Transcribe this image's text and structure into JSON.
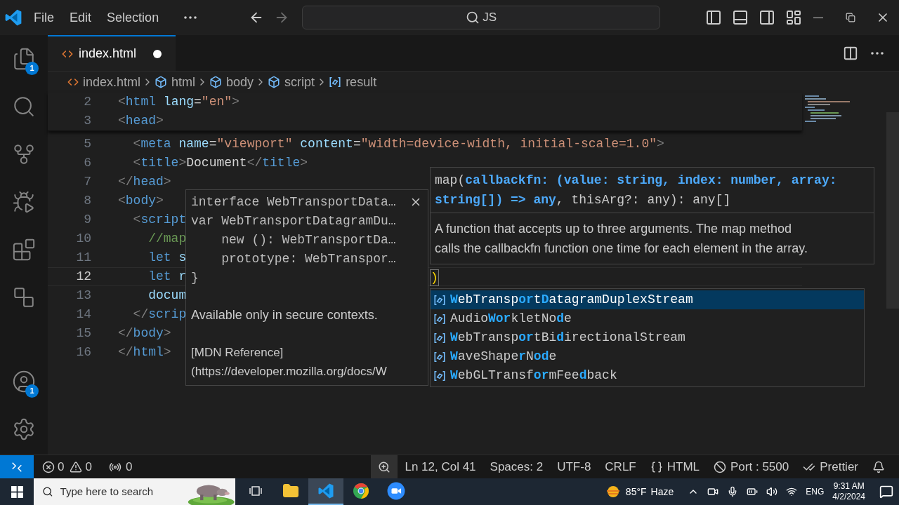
{
  "title_bar": {
    "menu": [
      "File",
      "Edit",
      "Selection"
    ],
    "command_center": "JS"
  },
  "activity_bar": {
    "top": [
      {
        "kind": "explorer",
        "badge": "1"
      },
      {
        "kind": "search"
      },
      {
        "kind": "source-control"
      },
      {
        "kind": "run-debug"
      },
      {
        "kind": "extensions"
      },
      {
        "kind": "remote"
      }
    ],
    "bottom": [
      {
        "kind": "accounts",
        "badge": "1"
      },
      {
        "kind": "settings"
      }
    ]
  },
  "tabs": [
    {
      "label": "index.html",
      "selected": true,
      "modified": true
    }
  ],
  "breadcrumbs": [
    {
      "label": "index.html",
      "kind": "file"
    },
    {
      "label": "html",
      "kind": "element"
    },
    {
      "label": "body",
      "kind": "element"
    },
    {
      "label": "script",
      "kind": "element"
    },
    {
      "label": "result",
      "kind": "variable"
    }
  ],
  "editor": {
    "sticky_lines": [
      {
        "number": "2",
        "current": false,
        "tokens": [
          {
            "kind": "p",
            "text": "<"
          },
          {
            "kind": "tag",
            "text": "html"
          },
          {
            "kind": "attr",
            "text": " lang"
          },
          {
            "kind": "text",
            "text": "="
          },
          {
            "kind": "str",
            "text": "\"en\""
          },
          {
            "kind": "p",
            "text": ">"
          }
        ]
      },
      {
        "number": "3",
        "current": false,
        "tokens": [
          {
            "kind": "p",
            "text": "<"
          },
          {
            "kind": "tag",
            "text": "head"
          },
          {
            "kind": "p",
            "text": ">"
          }
        ]
      }
    ],
    "lines": [
      {
        "number": "5",
        "current": false,
        "tokens": [
          {
            "kind": "p",
            "text": "  <"
          },
          {
            "kind": "tag",
            "text": "meta"
          },
          {
            "kind": "attr",
            "text": " name"
          },
          {
            "kind": "text",
            "text": "="
          },
          {
            "kind": "str",
            "text": "\"viewport\""
          },
          {
            "kind": "attr",
            "text": " content"
          },
          {
            "kind": "text",
            "text": "="
          },
          {
            "kind": "str",
            "text": "\"width=device-width, initial-scale=1.0\""
          },
          {
            "kind": "p",
            "text": ">"
          }
        ]
      },
      {
        "number": "6",
        "current": false,
        "tokens": [
          {
            "kind": "p",
            "text": "  <"
          },
          {
            "kind": "tag",
            "text": "title"
          },
          {
            "kind": "p",
            "text": ">"
          },
          {
            "kind": "text",
            "text": "Document"
          },
          {
            "kind": "p",
            "text": "</"
          },
          {
            "kind": "tag",
            "text": "title"
          },
          {
            "kind": "p",
            "text": ">"
          }
        ]
      },
      {
        "number": "7",
        "current": false,
        "tokens": [
          {
            "kind": "p",
            "text": "</"
          },
          {
            "kind": "tag",
            "text": "head"
          },
          {
            "kind": "p",
            "text": ">"
          }
        ]
      },
      {
        "number": "8",
        "current": false,
        "tokens": [
          {
            "kind": "p",
            "text": "<"
          },
          {
            "kind": "tag",
            "text": "body"
          },
          {
            "kind": "p",
            "text": ">"
          }
        ]
      },
      {
        "number": "9",
        "current": false,
        "tokens": [
          {
            "kind": "p",
            "text": "  <"
          },
          {
            "kind": "tag",
            "text": "script"
          }
        ]
      },
      {
        "number": "10",
        "current": false,
        "tokens": [
          {
            "kind": "comment",
            "text": "    //map"
          }
        ]
      },
      {
        "number": "11",
        "current": false,
        "tokens": [
          {
            "kind": "kw",
            "text": "    let"
          },
          {
            "kind": "var",
            "text": " s"
          }
        ]
      },
      {
        "number": "12",
        "current": true,
        "tokens": [
          {
            "kind": "kw",
            "text": "    let"
          },
          {
            "kind": "var",
            "text": " r"
          }
        ]
      },
      {
        "number": "13",
        "current": false,
        "tokens": [
          {
            "kind": "var",
            "text": "    docum"
          }
        ]
      },
      {
        "number": "14",
        "current": false,
        "tokens": [
          {
            "kind": "p",
            "text": "  </"
          },
          {
            "kind": "tag",
            "text": "scrip"
          }
        ]
      },
      {
        "number": "15",
        "current": false,
        "tokens": [
          {
            "kind": "p",
            "text": "</"
          },
          {
            "kind": "tag",
            "text": "body"
          },
          {
            "kind": "p",
            "text": ">"
          }
        ]
      },
      {
        "number": "16",
        "current": false,
        "tokens": [
          {
            "kind": "p",
            "text": "</"
          },
          {
            "kind": "tag",
            "text": "html"
          },
          {
            "kind": "p",
            "text": ">"
          }
        ]
      }
    ],
    "bracket": ")"
  },
  "hover": {
    "code": [
      "interface WebTransportData…",
      "var WebTransportDatagramDu…",
      "    new (): WebTransportDa…",
      "    prototype: WebTranspor…",
      "}"
    ],
    "doc": "Available only in secure contexts.",
    "reference": [
      "[MDN Reference]",
      "(https://developer.mozilla.org/docs/W"
    ]
  },
  "signature": {
    "segments": [
      {
        "text": "map(",
        "param": false
      },
      {
        "text": "callbackfn: (value: string, index: number, array: string[]) => any",
        "param": true
      },
      {
        "text": ", thisArg?: any): any[]",
        "param": false
      }
    ],
    "doc_lines": [
      "A function that accepts up to three arguments. The map method",
      "calls the callbackfn function one time for each element in the array."
    ]
  },
  "suggestions": [
    {
      "selected": true,
      "segments": [
        {
          "text": "W",
          "match": true
        },
        {
          "text": "ebTransp",
          "match": false
        },
        {
          "text": "or",
          "match": true
        },
        {
          "text": "t",
          "match": false
        },
        {
          "text": "D",
          "match": true
        },
        {
          "text": "atagramDuplexStream",
          "match": false
        }
      ]
    },
    {
      "selected": false,
      "segments": [
        {
          "text": "Audio",
          "match": false
        },
        {
          "text": "Wor",
          "match": true
        },
        {
          "text": "kletNo",
          "match": false
        },
        {
          "text": "d",
          "match": true
        },
        {
          "text": "e",
          "match": false
        }
      ]
    },
    {
      "selected": false,
      "segments": [
        {
          "text": "W",
          "match": true
        },
        {
          "text": "ebTransp",
          "match": false
        },
        {
          "text": "or",
          "match": true
        },
        {
          "text": "tBi",
          "match": false
        },
        {
          "text": "d",
          "match": true
        },
        {
          "text": "irectionalStream",
          "match": false
        }
      ]
    },
    {
      "selected": false,
      "segments": [
        {
          "text": "W",
          "match": true
        },
        {
          "text": "aveShape",
          "match": false
        },
        {
          "text": "r",
          "match": true
        },
        {
          "text": "N",
          "match": false
        },
        {
          "text": "od",
          "match": true
        },
        {
          "text": "e",
          "match": false
        }
      ]
    },
    {
      "selected": false,
      "segments": [
        {
          "text": "W",
          "match": true
        },
        {
          "text": "ebGLTransf",
          "match": false
        },
        {
          "text": "or",
          "match": true
        },
        {
          "text": "mFee",
          "match": false
        },
        {
          "text": "d",
          "match": true
        },
        {
          "text": "back",
          "match": false
        }
      ]
    }
  ],
  "status_bar": {
    "left": [
      {
        "kind": "problems",
        "errors": "0",
        "warnings": "0"
      },
      {
        "kind": "ports",
        "text": "0"
      }
    ],
    "right": [
      {
        "kind": "zoom",
        "highlighted": true
      },
      {
        "kind": "plain",
        "text": "Ln 12, Col 41"
      },
      {
        "kind": "plain",
        "text": "Spaces: 2"
      },
      {
        "kind": "plain",
        "text": "UTF-8"
      },
      {
        "kind": "plain",
        "text": "CRLF"
      },
      {
        "kind": "language",
        "text": "HTML"
      },
      {
        "kind": "live-server",
        "text": "Port : 5500"
      },
      {
        "kind": "prettier",
        "text": "Prettier"
      },
      {
        "kind": "notifications"
      }
    ]
  },
  "taskbar": {
    "search": {
      "placeholder": "Type here to search"
    },
    "apps": [
      {
        "kind": "task-view",
        "selected": false
      },
      {
        "kind": "file-explorer",
        "selected": false
      },
      {
        "kind": "vscode",
        "selected": true
      },
      {
        "kind": "chrome",
        "selected": false
      },
      {
        "kind": "zoom",
        "selected": false
      }
    ],
    "weather": {
      "temperature": "85°F",
      "condition": "Haze"
    },
    "language": "ENG",
    "time": "9:31 AM",
    "date": "4/2/2024"
  }
}
